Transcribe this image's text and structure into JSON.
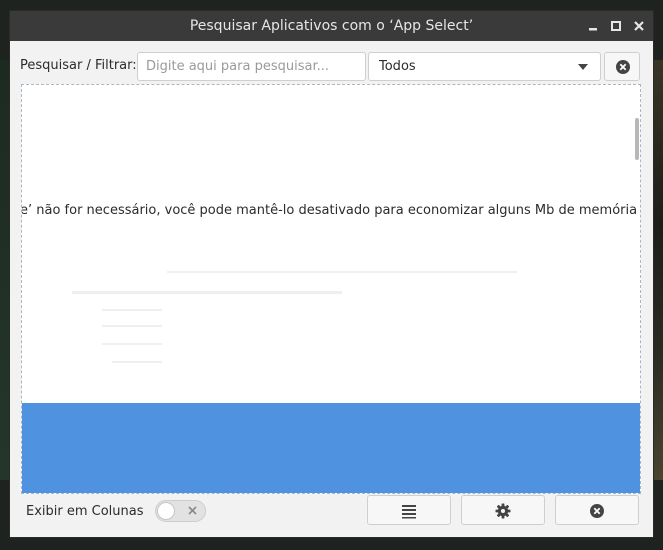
{
  "window": {
    "title": "Pesquisar Aplicativos com o ‘App Select’",
    "controls": [
      "minimize-icon",
      "maximize-icon",
      "close-icon"
    ]
  },
  "search": {
    "label": "Pesquisar / Filtrar:",
    "placeholder": "Digite aqui para pesquisar...",
    "value": "",
    "filter_selected": "Todos",
    "clear_icon": "clear-circle-icon"
  },
  "results": {
    "description": "e’ não for necessário, você pode mantê-lo desativado para economizar alguns Mb de memória RAM",
    "selected_row_color": "#4f92e0"
  },
  "footer": {
    "columns_label": "Exibir em Colunas",
    "columns_toggle_on": false,
    "buttons": [
      "list-icon",
      "gear-icon",
      "close-circle-icon"
    ]
  }
}
